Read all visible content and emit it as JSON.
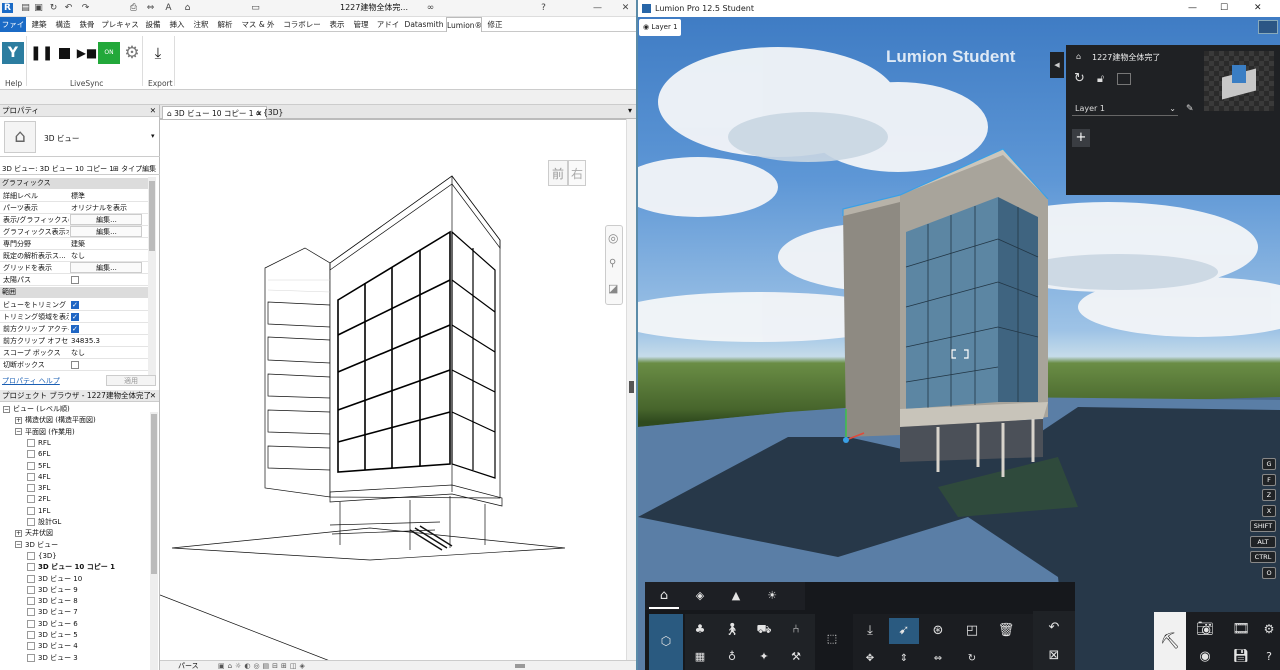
{
  "revit": {
    "qat_title": "1227建物全体完...",
    "ribbon_tabs": [
      "ファイル",
      "建築",
      "構造",
      "鉄骨",
      "プレキャスト",
      "設備",
      "挿入",
      "注釈",
      "解析",
      "マス & 外構",
      "コラボレート",
      "表示",
      "管理",
      "アドイン",
      "Datasmith",
      "Lumion®",
      "修正"
    ],
    "active_tab": "Lumion®",
    "ribbon_groups": [
      "Help",
      "LiveSync",
      "Export"
    ],
    "livesync_on_label": "ON",
    "properties": {
      "title": "プロパティ",
      "type_name": "3D ビュー",
      "selector_value": "3D ビュー: 3D ビュー 10 コピー 1",
      "edit_type_label": "タイプ編集",
      "section_graphics": "グラフィックス",
      "rows": [
        {
          "k": "詳細レベル",
          "v": "標準",
          "kind": "text"
        },
        {
          "k": "パーツ表示",
          "v": "オリジナルを表示",
          "kind": "text"
        },
        {
          "k": "表示/グラフィックスの...",
          "v": "編集...",
          "kind": "btn"
        },
        {
          "k": "グラフィックス表示オ...",
          "v": "編集...",
          "kind": "btn"
        },
        {
          "k": "専門分野",
          "v": "建築",
          "kind": "text"
        },
        {
          "k": "既定の解析表示ス...",
          "v": "なし",
          "kind": "text"
        },
        {
          "k": "グリッドを表示",
          "v": "編集...",
          "kind": "btn"
        },
        {
          "k": "太陽パス",
          "v": "",
          "kind": "cb0"
        }
      ],
      "section_extents": "範囲",
      "rows2": [
        {
          "k": "ビューをトリミング",
          "v": "",
          "kind": "cb1"
        },
        {
          "k": "トリミング領域を表示",
          "v": "",
          "kind": "cb1"
        },
        {
          "k": "前方クリップ アクティブ",
          "v": "",
          "kind": "cb1"
        },
        {
          "k": "前方クリップ オフセット",
          "v": "34835.3",
          "kind": "text"
        },
        {
          "k": "スコープ ボックス",
          "v": "なし",
          "kind": "text"
        },
        {
          "k": "切断ボックス",
          "v": "",
          "kind": "cb0"
        }
      ],
      "help_link": "プロパティ ヘルプ",
      "apply_label": "適用"
    },
    "browser": {
      "title": "プロジェクト ブラウザ - 1227建物全体完了",
      "items": [
        {
          "label": "ビュー (レベル順)",
          "lvl": 0,
          "t": "minus"
        },
        {
          "label": "構造伏図 (構造平面図)",
          "lvl": 1,
          "t": "plus"
        },
        {
          "label": "平面図 (作業用)",
          "lvl": 1,
          "t": "minus"
        },
        {
          "label": "RFL",
          "lvl": 2,
          "t": "view"
        },
        {
          "label": "6FL",
          "lvl": 2,
          "t": "view"
        },
        {
          "label": "5FL",
          "lvl": 2,
          "t": "view"
        },
        {
          "label": "4FL",
          "lvl": 2,
          "t": "view"
        },
        {
          "label": "3FL",
          "lvl": 2,
          "t": "view"
        },
        {
          "label": "2FL",
          "lvl": 2,
          "t": "view"
        },
        {
          "label": "1FL",
          "lvl": 2,
          "t": "view"
        },
        {
          "label": "設計GL",
          "lvl": 2,
          "t": "view"
        },
        {
          "label": "天井伏図",
          "lvl": 1,
          "t": "plus"
        },
        {
          "label": "3D ビュー",
          "lvl": 1,
          "t": "minus"
        },
        {
          "label": "{3D}",
          "lvl": 2,
          "t": "view"
        },
        {
          "label": "3D ビュー 10 コピー 1",
          "lvl": 2,
          "t": "view",
          "bold": true
        },
        {
          "label": "3D ビュー 10",
          "lvl": 2,
          "t": "view"
        },
        {
          "label": "3D ビュー 9",
          "lvl": 2,
          "t": "view"
        },
        {
          "label": "3D ビュー 8",
          "lvl": 2,
          "t": "view"
        },
        {
          "label": "3D ビュー 7",
          "lvl": 2,
          "t": "view"
        },
        {
          "label": "3D ビュー 6",
          "lvl": 2,
          "t": "view"
        },
        {
          "label": "3D ビュー 5",
          "lvl": 2,
          "t": "view"
        },
        {
          "label": "3D ビュー 4",
          "lvl": 2,
          "t": "view"
        },
        {
          "label": "3D ビュー 3",
          "lvl": 2,
          "t": "view"
        }
      ]
    },
    "view_tabs": [
      "3D ビュー 10 コピー 1",
      "{3D}"
    ],
    "viewcube": {
      "front": "前",
      "right": "右"
    },
    "status_label": "パース"
  },
  "lumion": {
    "title": "Lumion Pro 12.5 Student",
    "watermark": "Lumion Student",
    "layer_badge": "Layer 1",
    "panel": {
      "project": "1227建物全体完了",
      "layer_select": "Layer 1",
      "add_label": "+"
    },
    "keys": [
      "G",
      "F",
      "Z",
      "X",
      "SHIFT",
      "ALT",
      "CTRL",
      "O"
    ],
    "colors": {
      "accent": "#3d7fb4",
      "panel": "#1f2124",
      "toolbar": "#16181c",
      "selected": "#2a5a80"
    }
  }
}
